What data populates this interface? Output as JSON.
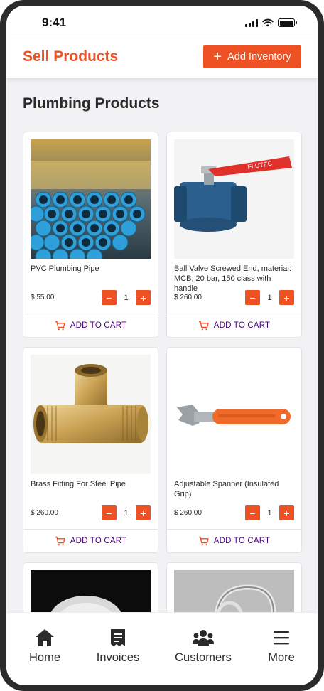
{
  "status": {
    "time": "9:41"
  },
  "header": {
    "title": "Sell Products",
    "add_button": "Add Inventory"
  },
  "section": {
    "title": "Plumbing Products"
  },
  "products": [
    {
      "name": "PVC Plumbing Pipe",
      "price": "$ 55.00",
      "qty": "1",
      "cart": "ADD TO CART"
    },
    {
      "name": "Ball Valve Screwed End, material: MCB, 20 bar, 150 class with handle",
      "price": "$ 260.00",
      "qty": "1",
      "cart": "ADD TO CART",
      "brand_text": "FLUTEC"
    },
    {
      "name": "Brass Fitting For Steel Pipe",
      "price": "$ 260.00",
      "qty": "1",
      "cart": "ADD TO CART"
    },
    {
      "name": "Adjustable Spanner (Insulated Grip)",
      "price": "$ 260.00",
      "qty": "1",
      "cart": "ADD TO CART"
    }
  ],
  "tabs": [
    {
      "label": "Home",
      "icon": "home-icon"
    },
    {
      "label": "Invoices",
      "icon": "invoice-icon"
    },
    {
      "label": "Customers",
      "icon": "customers-icon"
    },
    {
      "label": "More",
      "icon": "menu-icon"
    }
  ],
  "colors": {
    "accent": "#ee5124",
    "cart_text": "#4b0082",
    "background": "#f2f2f4"
  }
}
